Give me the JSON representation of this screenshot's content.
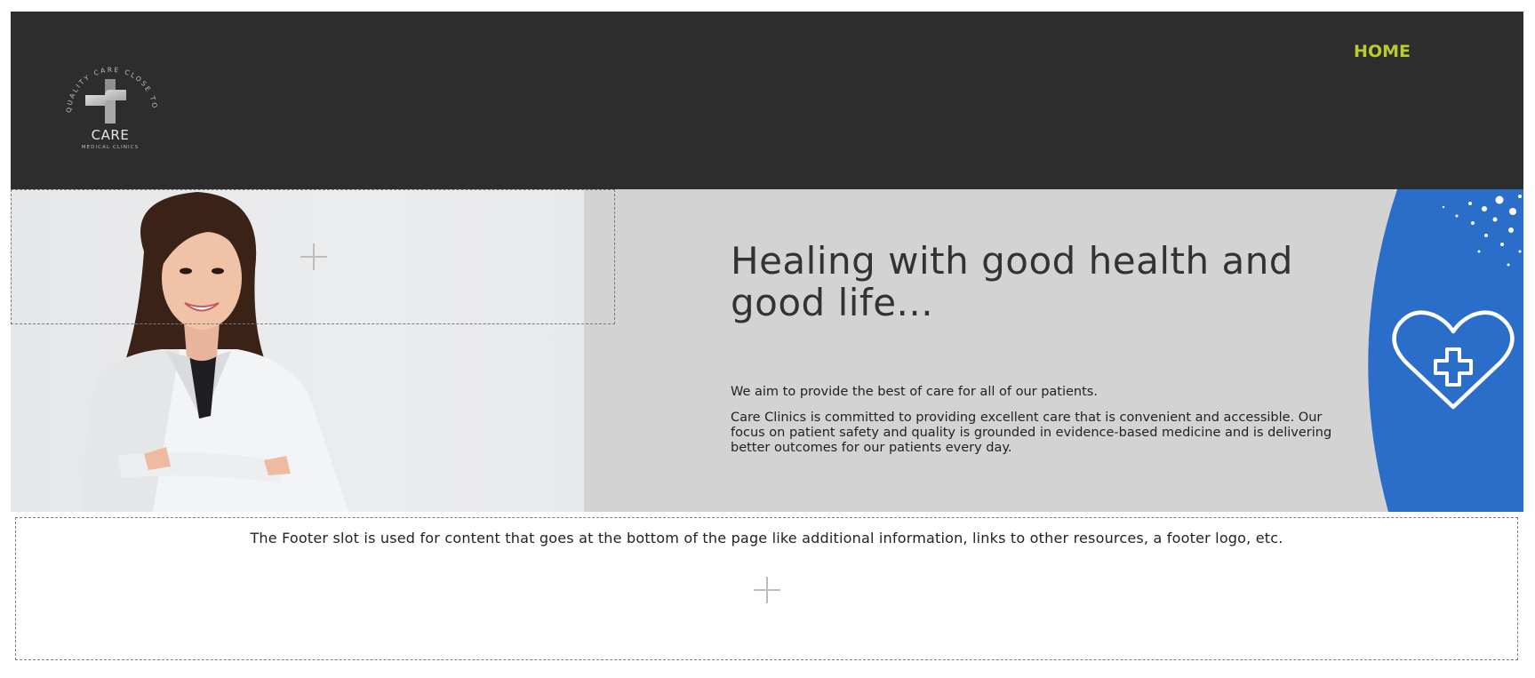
{
  "header": {
    "logo": {
      "ring_text": "QUALITY CARE CLOSE TO HOME",
      "name": "CARE",
      "tagline": "MEDICAL CLINICS"
    },
    "nav": {
      "home_label": "HOME"
    }
  },
  "hero": {
    "title": "Healing with good health and good life...",
    "subtitle": "We aim to provide the best of care for all of our patients.",
    "body": "Care Clinics is committed to providing excellent care that is convenient and accessible. Our focus on patient safety and quality is grounded in evidence-based medicine and is delivering better outcomes for our patients every day."
  },
  "footer_slot": {
    "text": "The Footer slot is used for content that goes at the bottom of the page like additional information, links to other resources, a footer logo, etc."
  },
  "colors": {
    "header_bg": "#2d2d2d",
    "nav_accent": "#b8cc2a",
    "hero_bg": "#d3d3d3",
    "badge_blue": "#2a6ec9"
  },
  "icons": {
    "logo": "medical-cross-logo",
    "hero_badge": "heart-plus-icon",
    "slot_add": "plus-icon"
  }
}
